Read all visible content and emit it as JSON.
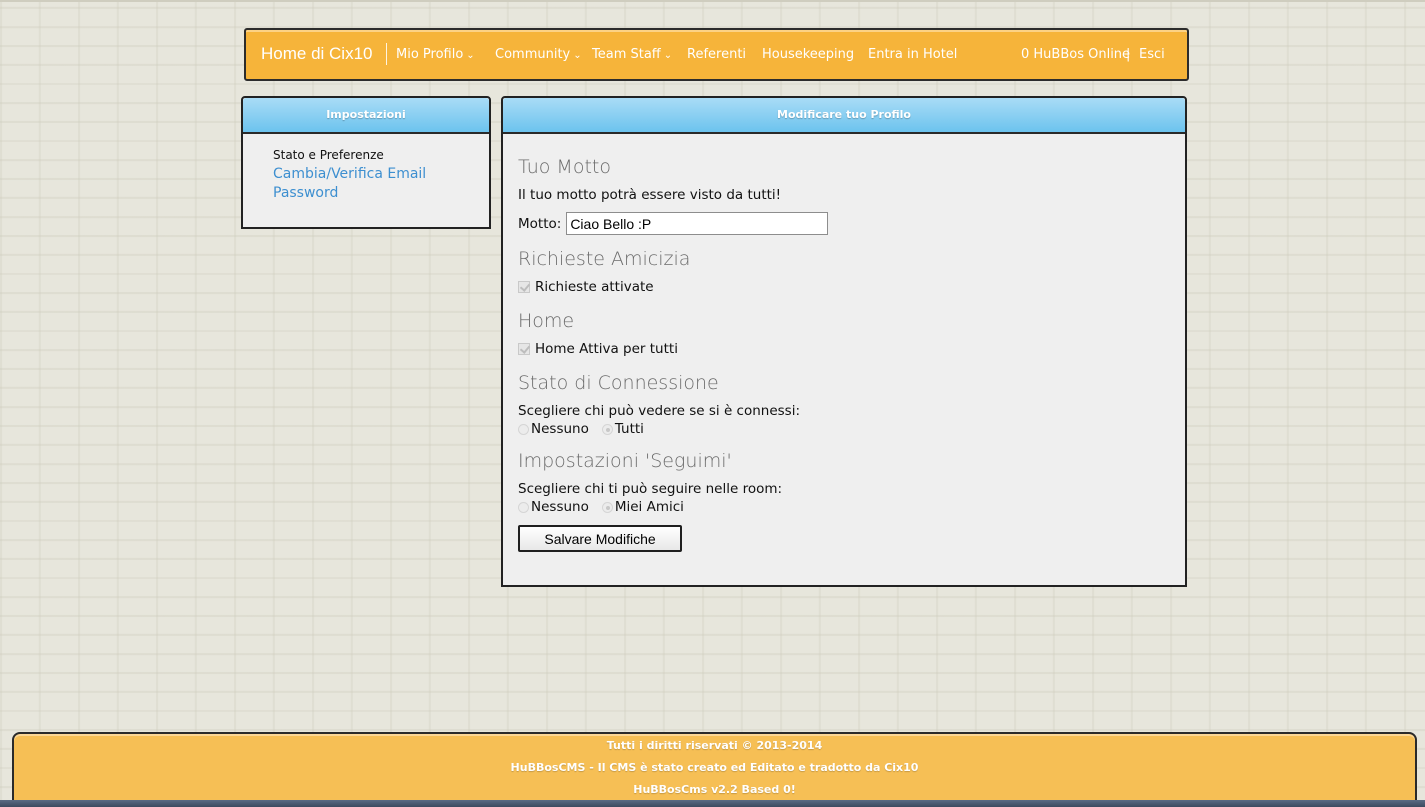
{
  "colors": {
    "nav_bg": "#f6b43a",
    "panel_header": "#6cc3ee",
    "link": "#3d8fd0",
    "footer_bg": "#f6bf55"
  },
  "navbar": {
    "brand": "Home di Cix10",
    "items": [
      {
        "label": "Mio Profilo",
        "has_dropdown": true
      },
      {
        "label": "Community",
        "has_dropdown": true
      },
      {
        "label": "Team Staff",
        "has_dropdown": true
      },
      {
        "label": "Referenti",
        "has_dropdown": false
      },
      {
        "label": "Housekeeping",
        "has_dropdown": false
      },
      {
        "label": "Entra in Hotel",
        "has_dropdown": false
      }
    ],
    "online": "0 HuBBos Online",
    "separator": "|",
    "logout": "Esci",
    "dropdown_icon": "chevron-down-icon"
  },
  "sidebar": {
    "title": "Impostazioni",
    "items": [
      {
        "label": "Stato e Preferenze",
        "active": true
      },
      {
        "label": "Cambia/Verifica Email",
        "active": false
      },
      {
        "label": "Password",
        "active": false
      }
    ]
  },
  "main": {
    "title": "Modificare tuo Profilo",
    "motto": {
      "heading": "Tuo Motto",
      "description": "Il tuo motto potrà essere visto da tutti!",
      "label": "Motto:",
      "value": "Ciao Bello :P"
    },
    "friends": {
      "heading": "Richieste Amicizia",
      "checkbox_label": "Richieste attivate",
      "checked": true
    },
    "home": {
      "heading": "Home",
      "checkbox_label": "Home Attiva per tutti",
      "checked": true
    },
    "status": {
      "heading": "Stato di Connessione",
      "description": "Scegliere chi può vedere se si è connessi:",
      "options": [
        "Nessuno",
        "Tutti"
      ],
      "selected": "Tutti"
    },
    "follow": {
      "heading": "Impostazioni 'Seguimi'",
      "description": "Scegliere chi ti può seguire nelle room:",
      "options": [
        "Nessuno",
        "Miei Amici"
      ],
      "selected": "Miei Amici"
    },
    "save_label": "Salvare Modifiche"
  },
  "footer": {
    "line1": "Tutti i diritti riservati © 2013-2014",
    "line2": "HuBBosCMS - Il CMS è stato creato ed Editato e tradotto da Cix10",
    "line3": "HuBBosCms v2.2 Based 0!"
  }
}
